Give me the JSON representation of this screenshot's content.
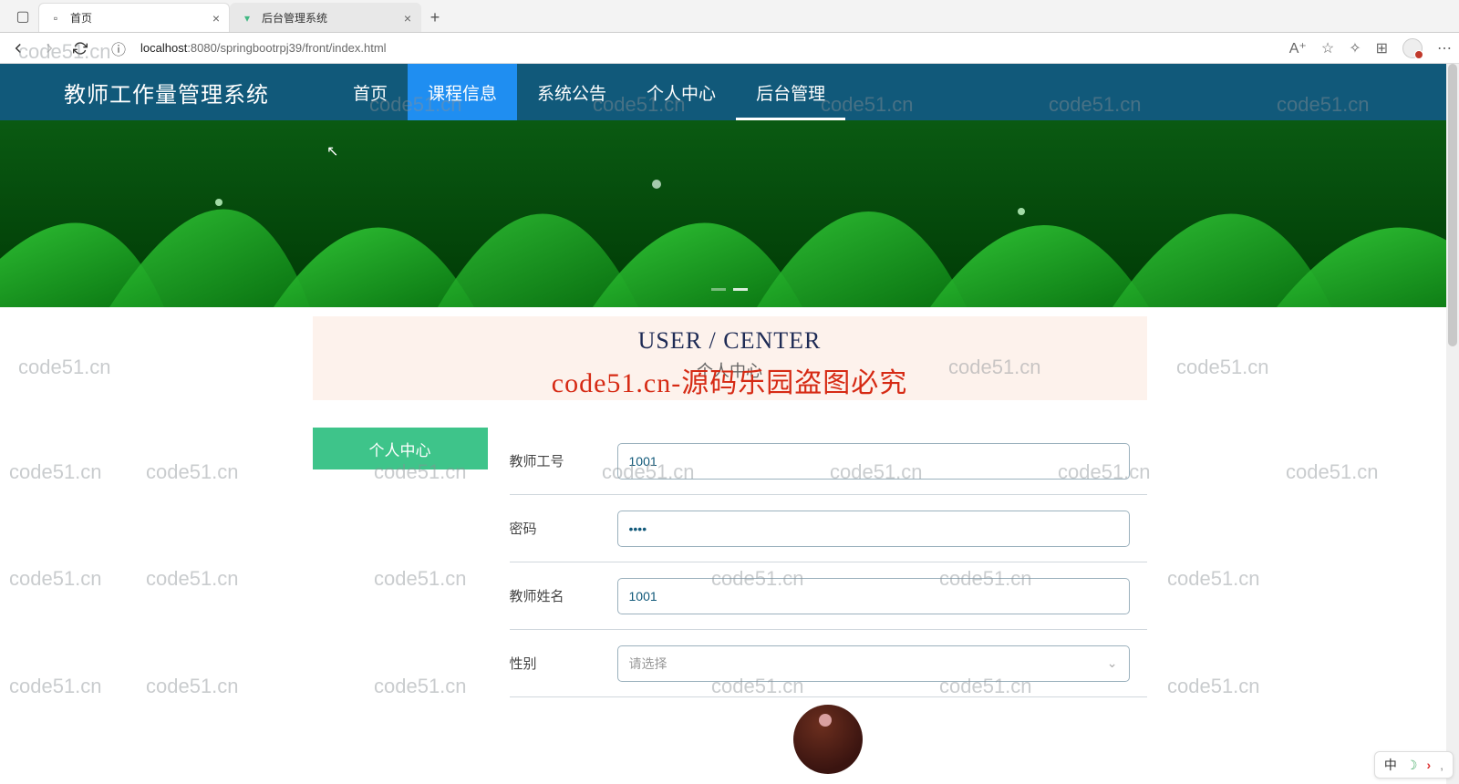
{
  "browser": {
    "tabs": [
      {
        "title": "首页"
      },
      {
        "title": "后台管理系统"
      }
    ],
    "url_host": "localhost",
    "url_port": ":8080",
    "url_path": "/springbootrpj39/front/index.html"
  },
  "topnav": {
    "brand": "教师工作量管理系统",
    "items": [
      "首页",
      "课程信息",
      "系统公告",
      "个人中心",
      "后台管理"
    ]
  },
  "section": {
    "title_en": "USER / CENTER",
    "title_cn": "个人中心"
  },
  "overlay": "code51.cn-源码乐园盗图必究",
  "side_button": "个人中心",
  "form": {
    "f1": {
      "label": "教师工号",
      "value": "1001"
    },
    "f2": {
      "label": "密码",
      "value": "••••"
    },
    "f3": {
      "label": "教师姓名",
      "value": "1001"
    },
    "f4": {
      "label": "性别",
      "placeholder": "请选择"
    }
  },
  "ime": {
    "lang": "中"
  },
  "watermark": "code51.cn"
}
